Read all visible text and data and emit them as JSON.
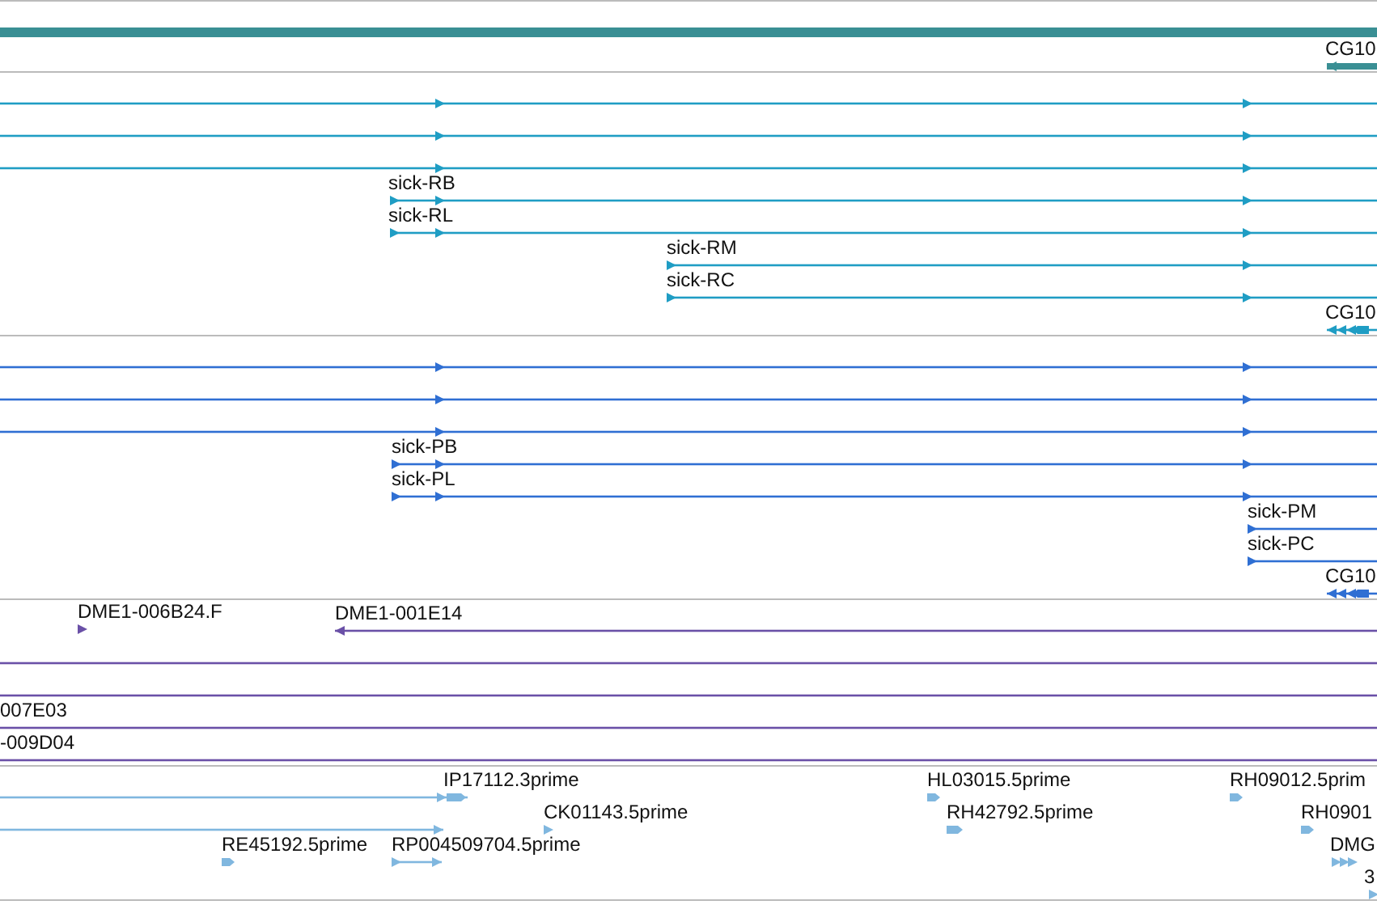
{
  "tracks": [
    {
      "color": "#3a8f94",
      "features": [
        {
          "kind": "span"
        },
        {
          "kind": "span",
          "label": "CG10",
          "reverse": true
        }
      ]
    },
    {
      "color": "#1f9dc4",
      "features": [
        {
          "kind": "transcript",
          "reverse": false
        },
        {
          "kind": "transcript",
          "reverse": false
        },
        {
          "kind": "transcript",
          "reverse": false
        },
        {
          "kind": "transcript",
          "label": "sick-RB",
          "reverse": false
        },
        {
          "kind": "transcript",
          "label": "sick-RL",
          "reverse": false
        },
        {
          "kind": "transcript",
          "label": "sick-RM",
          "reverse": false
        },
        {
          "kind": "transcript",
          "label": "sick-RC",
          "reverse": false
        },
        {
          "kind": "transcript",
          "label": "CG10",
          "reverse": true
        }
      ]
    },
    {
      "color": "#2f6fd3",
      "features": [
        {
          "kind": "transcript",
          "reverse": false
        },
        {
          "kind": "transcript",
          "reverse": false
        },
        {
          "kind": "transcript",
          "reverse": false
        },
        {
          "kind": "transcript",
          "label": "sick-PB",
          "reverse": false
        },
        {
          "kind": "transcript",
          "label": "sick-PL",
          "reverse": false
        },
        {
          "kind": "transcript",
          "label": "sick-PM",
          "reverse": false
        },
        {
          "kind": "transcript",
          "label": "sick-PC",
          "reverse": false
        },
        {
          "kind": "transcript",
          "label": "CG10",
          "reverse": true
        }
      ]
    },
    {
      "color": "#6a50a7",
      "features": [
        {
          "kind": "read",
          "label": "DME1-006B24.F",
          "reverse": false
        },
        {
          "kind": "transcript",
          "label": "DME1-001E14",
          "reverse": true
        },
        {
          "kind": "transcript"
        },
        {
          "kind": "transcript"
        },
        {
          "kind": "transcript",
          "label": "007E03"
        },
        {
          "kind": "transcript",
          "label": "-009D04"
        }
      ]
    },
    {
      "color": "#80b7df",
      "features": [
        {
          "kind": "transcript",
          "label": "IP17112.3prime",
          "reverse": false
        },
        {
          "kind": "read",
          "label": "CK01143.5prime",
          "reverse": false
        },
        {
          "kind": "transcript",
          "reverse": false
        },
        {
          "kind": "read",
          "label": "RE45192.5prime",
          "reverse": false
        },
        {
          "kind": "transcript",
          "label": "RP004509704.5prime",
          "reverse": false
        },
        {
          "kind": "read",
          "label": "HL03015.5prime",
          "reverse": false
        },
        {
          "kind": "read",
          "label": "RH42792.5prime",
          "reverse": false
        },
        {
          "kind": "read",
          "label": "RH09012.5prim",
          "reverse": false
        },
        {
          "kind": "read",
          "label": "RH0901",
          "reverse": false
        },
        {
          "kind": "read",
          "label": "DMG",
          "reverse": false
        },
        {
          "kind": "read",
          "label": "3",
          "reverse": false
        }
      ]
    }
  ]
}
